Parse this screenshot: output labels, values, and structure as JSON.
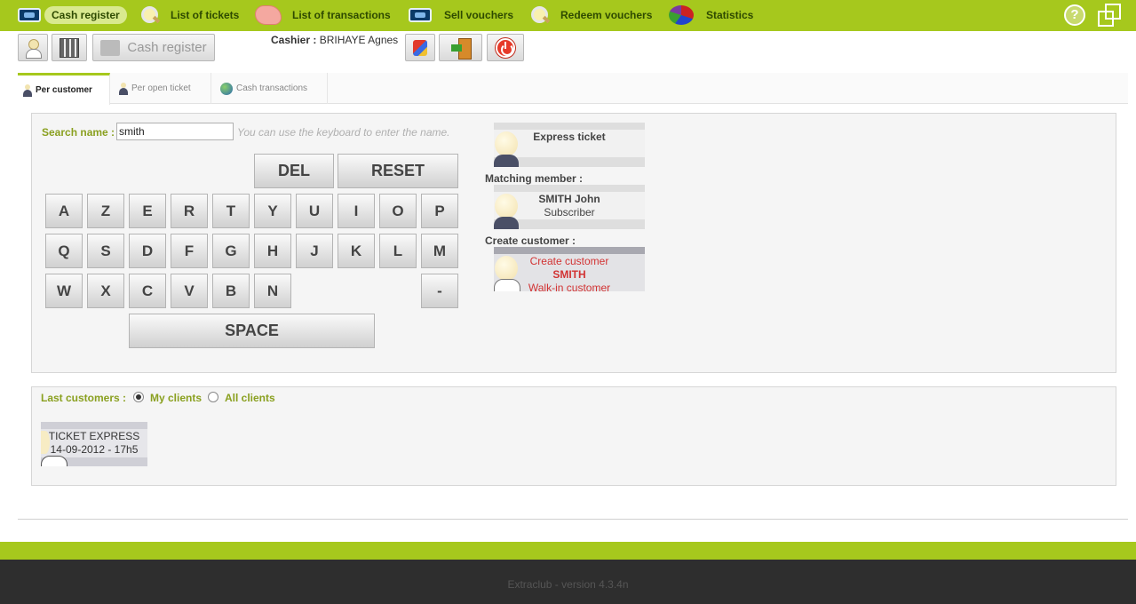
{
  "nav": {
    "items": [
      {
        "label": "Cash register",
        "icon": "ticket-icon"
      },
      {
        "label": "List of tickets",
        "icon": "magnifier-icon"
      },
      {
        "label": "List of transactions",
        "icon": "hand-icon"
      },
      {
        "label": "Sell vouchers",
        "icon": "ticket-icon"
      },
      {
        "label": "Redeem vouchers",
        "icon": "magnifier-icon"
      },
      {
        "label": "Statistics",
        "icon": "pie-chart-icon"
      }
    ],
    "help": "?"
  },
  "toolbar": {
    "cash_register_label": "Cash register",
    "cashier_label": "Cashier :",
    "cashier_name": " BRIHAYE Agnes"
  },
  "tabs": [
    {
      "label": "Per customer"
    },
    {
      "label": "Per open ticket"
    },
    {
      "label": "Cash transactions"
    }
  ],
  "search": {
    "label": "Search name :",
    "value": "smith",
    "hint": "You can use the keyboard to enter the name."
  },
  "keyboard": {
    "del": "DEL",
    "reset": "RESET",
    "row1": [
      "A",
      "Z",
      "E",
      "R",
      "T",
      "Y",
      "U",
      "I",
      "O",
      "P"
    ],
    "row2": [
      "Q",
      "S",
      "D",
      "F",
      "G",
      "H",
      "J",
      "K",
      "L",
      "M"
    ],
    "row3": [
      "W",
      "X",
      "C",
      "V",
      "B",
      "N"
    ],
    "dash": "-",
    "space": "SPACE"
  },
  "express": {
    "label": "Express ticket"
  },
  "matching": {
    "heading": "Matching member :",
    "name": "SMITH John",
    "type": "Subscriber"
  },
  "create": {
    "heading": "Create customer :",
    "line1": "Create customer",
    "line2": "SMITH",
    "line3": "Walk-in customer"
  },
  "last_customers": {
    "label": "Last customers :",
    "options": [
      {
        "label": "My clients",
        "checked": true
      },
      {
        "label": "All clients",
        "checked": false
      }
    ],
    "recent": [
      {
        "name": "TICKET EXPRESS",
        "date": "14-09-2012 - 17h5"
      }
    ]
  },
  "footer": {
    "text": "Extraclub - version 4.3.4n"
  },
  "colors": {
    "accent": "#a6c81d",
    "label_green": "#8aa020",
    "create_red": "#d23333",
    "footer_dark": "#2e2e2e"
  }
}
